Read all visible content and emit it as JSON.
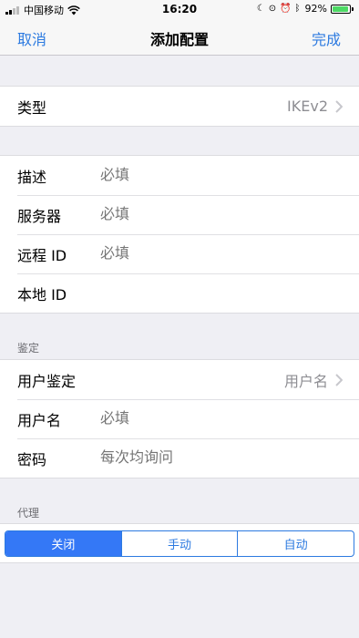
{
  "status_bar": {
    "carrier": "中国移动",
    "time": "16:20",
    "battery_percent": "92%",
    "battery_level": 0.92
  },
  "nav": {
    "cancel_label": "取消",
    "title": "添加配置",
    "done_label": "完成"
  },
  "type_group": {
    "label": "类型",
    "value": "IKEv2"
  },
  "server_group": {
    "rows": [
      {
        "label": "描述",
        "placeholder": "必填"
      },
      {
        "label": "服务器",
        "placeholder": "必填"
      },
      {
        "label": "远程 ID",
        "placeholder": "必填"
      },
      {
        "label": "本地 ID",
        "placeholder": ""
      }
    ]
  },
  "auth_section": {
    "header": "鉴定",
    "user_auth_label": "用户鉴定",
    "user_auth_value": "用户名",
    "username_label": "用户名",
    "username_placeholder": "必填",
    "password_label": "密码",
    "password_placeholder": "每次均询问"
  },
  "proxy_section": {
    "header": "代理",
    "options": [
      "关闭",
      "手动",
      "自动"
    ],
    "selected": "关闭"
  },
  "colors": {
    "accent": "#2c7ae0",
    "segment_selected": "#3478f6",
    "background": "#efeff4",
    "battery": "#4cd964"
  }
}
